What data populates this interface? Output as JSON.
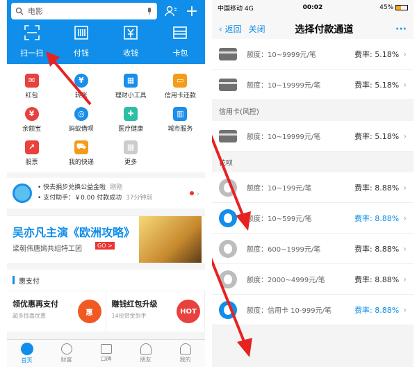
{
  "left": {
    "search": {
      "placeholder": "电影"
    },
    "quick": [
      {
        "label": "扫一扫",
        "icon": "scan-icon"
      },
      {
        "label": "付钱",
        "icon": "pay-icon"
      },
      {
        "label": "收钱",
        "icon": "receive-icon"
      },
      {
        "label": "卡包",
        "icon": "card-wallet-icon"
      }
    ],
    "grid": [
      [
        {
          "label": "红包",
          "icon": "red-packet-icon",
          "color": "#e8413e"
        },
        {
          "label": "转账",
          "icon": "transfer-icon",
          "color": "#1b8ee9"
        },
        {
          "label": "理财小工具",
          "icon": "calculator-icon",
          "color": "#1b8ee9"
        },
        {
          "label": "信用卡还款",
          "icon": "credit-card-icon",
          "color": "#f39c1a"
        }
      ],
      [
        {
          "label": "余额宝",
          "icon": "yuebao-icon",
          "color": "#e8413e"
        },
        {
          "label": "蚂蚁借呗",
          "icon": "jiebei-icon",
          "color": "#1b8ee9"
        },
        {
          "label": "医疗健康",
          "icon": "health-icon",
          "color": "#2bbfa4"
        },
        {
          "label": "城市服务",
          "icon": "city-icon",
          "color": "#1b8ee9"
        }
      ],
      [
        {
          "label": "股票",
          "icon": "stock-icon",
          "color": "#e8413e"
        },
        {
          "label": "我的快递",
          "icon": "delivery-icon",
          "color": "#f39c1a"
        },
        {
          "label": "更多",
          "icon": "more-grid-icon",
          "color": "#cccccc"
        }
      ]
    ],
    "notice": {
      "line1": "• 快去捐步兑换公益金啦",
      "line1_time": "刚刚",
      "line2": "• 支付助手：￥0.00 付款成功",
      "line2_time": "37分钟前"
    },
    "banner": {
      "title": "吴亦凡主演《欧洲攻略》",
      "subtitle": "梁朝伟唐嫣共组特工团",
      "go": "GO >"
    },
    "section_title": "惠支付",
    "cards": [
      {
        "title": "领优惠再支付",
        "sub": "超多惊喜优惠",
        "badge": "惠"
      },
      {
        "title": "赚钱红包升级",
        "sub": "14份赏金到手",
        "badge": "HOT"
      }
    ],
    "tabs": [
      {
        "label": "首页",
        "icon": "home-icon",
        "active": true
      },
      {
        "label": "财富",
        "icon": "wealth-icon",
        "active": false
      },
      {
        "label": "口碑",
        "icon": "koubei-icon",
        "active": false
      },
      {
        "label": "朋友",
        "icon": "friends-icon",
        "active": false
      },
      {
        "label": "我的",
        "icon": "profile-icon",
        "active": false
      }
    ]
  },
  "right": {
    "status": {
      "carrier": "中国移动  4G",
      "time": "00:02",
      "battery": "45%"
    },
    "nav": {
      "back": "返回",
      "close": "关闭",
      "title": "选择付款通道",
      "more": "···"
    },
    "rows": [
      {
        "kind": "card",
        "quota": "额度：10~9999元/笔",
        "rate": "费率: 5.18%"
      },
      {
        "kind": "card",
        "quota": "额度：10~19999元/笔",
        "rate": "费率: 5.18%"
      },
      {
        "kind": "group",
        "label": "信用卡(风控)"
      },
      {
        "kind": "card",
        "quota": "额度：10~19999元/笔",
        "rate": "费率: 5.18%"
      },
      {
        "kind": "group",
        "label": "花呗"
      },
      {
        "kind": "huabei",
        "quota": "额度：10~199元/笔",
        "rate": "费率: 8.88%"
      },
      {
        "kind": "huabei-sel",
        "quota": "额度：10~599元/笔",
        "rate": "费率: 8.88%"
      },
      {
        "kind": "huabei",
        "quota": "额度：600~1999元/笔",
        "rate": "费率: 8.88%"
      },
      {
        "kind": "huabei",
        "quota": "额度：2000~4999元/笔",
        "rate": "费率: 8.88%"
      },
      {
        "kind": "huabei-sel",
        "quota": "额度：信用卡 10-999元/笔",
        "rate": "费率: 8.88%"
      }
    ]
  }
}
